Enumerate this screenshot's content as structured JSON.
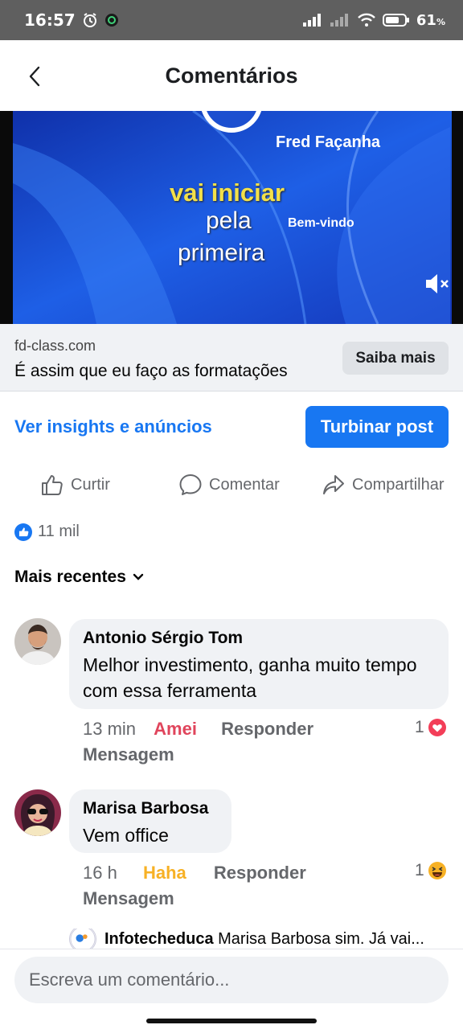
{
  "status_bar": {
    "time": "16:57",
    "battery": "61"
  },
  "header": {
    "title": "Comentários"
  },
  "video": {
    "line1": "Fred Façanha",
    "line2": "vai iniciar",
    "line3": "pela",
    "line4": "Bem-vindo",
    "line5": "primeira"
  },
  "link_preview": {
    "domain": "fd-class.com",
    "headline": "É assim que eu faço as formatações",
    "cta": "Saiba mais"
  },
  "promo": {
    "insights": "Ver insights e anúncios",
    "boost": "Turbinar post"
  },
  "actions": {
    "like": "Curtir",
    "comment": "Comentar",
    "share": "Compartilhar"
  },
  "reactions": {
    "count": "11 mil"
  },
  "sort": {
    "label": "Mais recentes"
  },
  "comments": [
    {
      "author": "Antonio Sérgio Tom",
      "text": "Melhor investimento, ganha muito tempo com essa ferramenta",
      "time": "13 min",
      "reaction_label": "Amei",
      "reply": "Responder",
      "message": "Mensagem",
      "count": "1"
    },
    {
      "author": "Marisa Barbosa",
      "text": "Vem office",
      "time": "16 h",
      "reaction_label": "Haha",
      "reply": "Responder",
      "message": "Mensagem",
      "count": "1"
    }
  ],
  "reply_preview": {
    "author": "Infotecheduca",
    "text": "Marisa Barbosa sim. Já vai..."
  },
  "composer": {
    "placeholder": "Escreva um comentário..."
  },
  "colors": {
    "accent": "#1877f2",
    "love": "#e0455c",
    "haha": "#f7b125"
  }
}
